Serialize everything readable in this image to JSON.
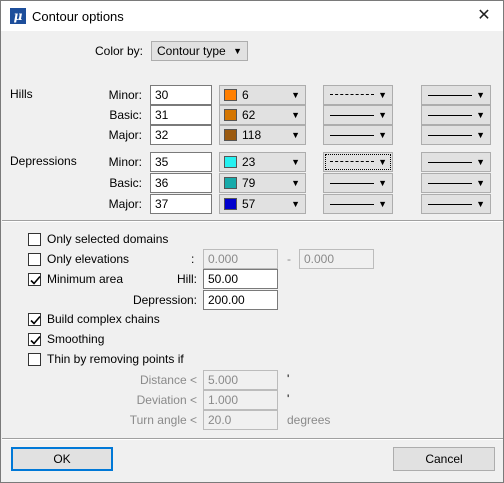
{
  "window": {
    "title": "Contour options"
  },
  "color_by": {
    "label": "Color by:",
    "value": "Contour type"
  },
  "groups": [
    {
      "name": "Hills",
      "rows": [
        {
          "label": "Minor:",
          "value": "30",
          "color_code": "6",
          "color": "#ff7f00",
          "line1": "dashed",
          "line2": "solid"
        },
        {
          "label": "Basic:",
          "value": "31",
          "color_code": "62",
          "color": "#d47500",
          "line1": "solid",
          "line2": "solid"
        },
        {
          "label": "Major:",
          "value": "32",
          "color_code": "118",
          "color": "#9b5a10",
          "line1": "solid",
          "line2": "solid"
        }
      ]
    },
    {
      "name": "Depressions",
      "rows": [
        {
          "label": "Minor:",
          "value": "35",
          "color_code": "23",
          "color": "#26f0f0",
          "line1": "dashed",
          "line2": "solid"
        },
        {
          "label": "Basic:",
          "value": "36",
          "color_code": "79",
          "color": "#17aaaa",
          "line1": "solid",
          "line2": "solid"
        },
        {
          "label": "Major:",
          "value": "37",
          "color_code": "57",
          "color": "#0000cc",
          "line1": "solid",
          "line2": "solid"
        }
      ]
    }
  ],
  "options": {
    "only_selected_domains": {
      "label": "Only selected domains",
      "checked": false
    },
    "only_elevations": {
      "label": "Only elevations",
      "checked": false,
      "colon": ":",
      "from": "0.000",
      "dash": "-",
      "to": "0.000"
    },
    "minimum_area": {
      "label": "Minimum area",
      "checked": true,
      "hill_label": "Hill:",
      "hill_value": "50.00",
      "depression_label": "Depression:",
      "depression_value": "200.00"
    },
    "build_complex_chains": {
      "label": "Build complex chains",
      "checked": true
    },
    "smoothing": {
      "label": "Smoothing",
      "checked": true
    },
    "thin": {
      "label": "Thin by removing points if",
      "checked": false,
      "distance_label": "Distance <",
      "distance_value": "5.000",
      "distance_unit": "'",
      "deviation_label": "Deviation <",
      "deviation_value": "1.000",
      "deviation_unit": "'",
      "turn_label": "Turn angle <",
      "turn_value": "20.0",
      "turn_unit": "degrees"
    }
  },
  "buttons": {
    "ok": "OK",
    "cancel": "Cancel"
  },
  "icons": {
    "app": "microstation-icon",
    "close": "close-icon",
    "dropdown": "chevron-down-icon"
  }
}
